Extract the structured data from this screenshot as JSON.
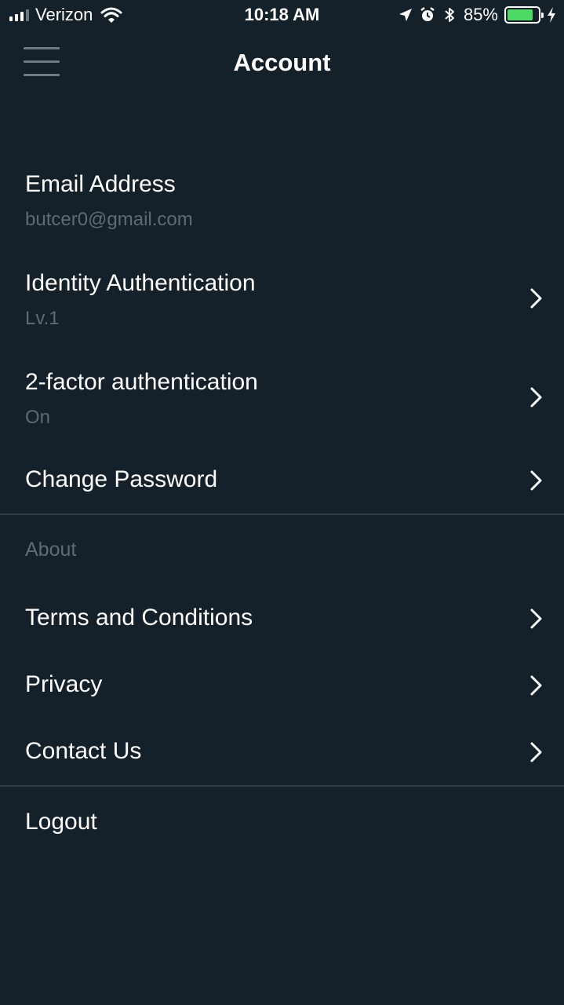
{
  "status_bar": {
    "carrier": "Verizon",
    "time": "10:18 AM",
    "battery_percent": "85%",
    "battery_level": 0.85,
    "icons": [
      "signal-icon",
      "wifi-icon",
      "location-icon",
      "alarm-icon",
      "bluetooth-icon",
      "battery-icon",
      "charging-icon"
    ]
  },
  "header": {
    "title": "Account",
    "menu_icon": "hamburger-menu-icon"
  },
  "account": {
    "email_label": "Email Address",
    "email_value": "butcer0@gmail.com",
    "identity_label": "Identity Authentication",
    "identity_value": "Lv.1",
    "twofa_label": "2-factor authentication",
    "twofa_value": "On",
    "password_label": "Change Password"
  },
  "about": {
    "section_label": "About",
    "terms_label": "Terms and Conditions",
    "privacy_label": "Privacy",
    "contact_label": "Contact Us"
  },
  "logout_label": "Logout",
  "colors": {
    "background": "#15212a",
    "primary_text": "#ffffff",
    "secondary_text": "#5e6b73",
    "divider": "#2f3b43",
    "battery_fill": "#4cd964"
  }
}
